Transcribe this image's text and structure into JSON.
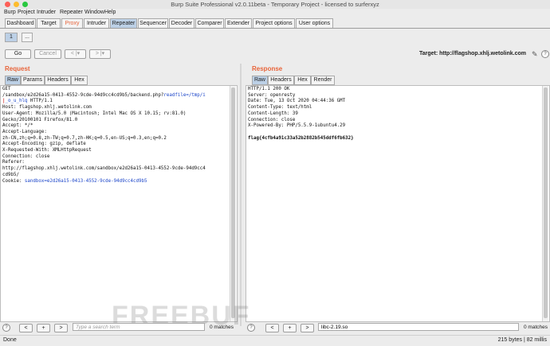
{
  "window": {
    "title": "Burp Suite Professional v2.0.11beta - Temporary Project - licensed to surferxyz"
  },
  "menu": [
    "Burp",
    "Project",
    "Intruder",
    "Repeater",
    "Window",
    "Help"
  ],
  "main_tabs": [
    "Dashboard",
    "Target",
    "Proxy",
    "Intruder",
    "Repeater",
    "Sequencer",
    "Decoder",
    "Comparer",
    "Extender",
    "Project options",
    "User options"
  ],
  "repeater_tabs": [
    "1",
    "..."
  ],
  "controls": {
    "go": "Go",
    "cancel": "Cancel",
    "back": "< |▾",
    "forward": "> |▾"
  },
  "target": "Target: http://flagshop.xhlj.wetolink.com",
  "request": {
    "title": "Request",
    "tabs": [
      "Raw",
      "Params",
      "Headers",
      "Hex"
    ],
    "search_placeholder": "Type a search term",
    "matches": "0 matches"
  },
  "response": {
    "title": "Response",
    "tabs": [
      "Raw",
      "Headers",
      "Hex",
      "Render"
    ],
    "search_value": "libc-2.19.so",
    "matches": "0 matches",
    "lines": [
      "HTTP/1.1 200 OK",
      "Server: openresty",
      "Date: Tue, 13 Oct 2020 04:44:36 GMT",
      "Content-Type: text/html",
      "Content-Length: 39",
      "Connection: close",
      "X-Powered-By: PHP/5.5.9-1ubuntu4.29",
      "",
      "flag{4cfb4a91c33a52b2882b545ddf6fb632}"
    ]
  },
  "request_lines": {
    "l1": "GET",
    "l2a": "/sandbox/e2d26a15-0413-4552-9cde-94d9cc4cd9b5/backend.php?",
    "l2b": "readfile=/tmp/i",
    "l3a": "_o_u_hlq",
    "l3b": " HTTP/1.1",
    "l4": "Host: flagshop.xhlj.wetolink.com",
    "l5": "User-Agent: Mozilla/5.0 (Macintosh; Intel Mac OS X 10.15; rv:81.0)",
    "l6": "Gecko/20100101 Firefox/81.0",
    "l7": "Accept: */*",
    "l8": "Accept-Language:",
    "l9": "zh-CN,zh;q=0.8,zh-TW;q=0.7,zh-HK;q=0.5,en-US;q=0.3,en;q=0.2",
    "l10": "Accept-Encoding: gzip, deflate",
    "l11": "X-Requested-With: XMLHttpRequest",
    "l12": "Connection: close",
    "l13": "Referer:",
    "l14": "http://flagshop.xhlj.wetolink.com/sandbox/e2d26a15-0413-4552-9cde-94d9cc4",
    "l15": "cd9b5/",
    "l16a": "Cookie: ",
    "l16b": "sandbox",
    "l16c": "=e2d26a15-0413-4552-9cde-94d9cc4cd9b5"
  },
  "status": {
    "left": "Done",
    "right": "215 bytes | 82 millis"
  },
  "watermark": "FREEBUF",
  "colors": {
    "accent": "#e8643a",
    "tab_active": "#bcd0e6",
    "param_blue": "#1a44c9"
  }
}
